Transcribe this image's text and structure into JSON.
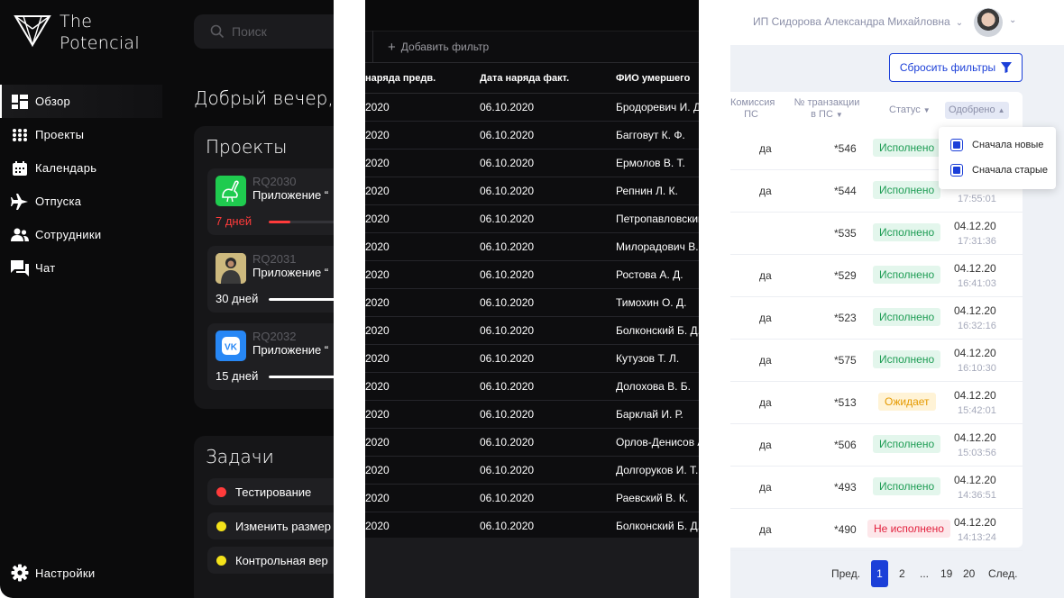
{
  "dashboard": {
    "logo_text": "The Potencial",
    "search_placeholder": "Поиск",
    "nav": [
      {
        "label": "Обзор",
        "icon": "grid-icon"
      },
      {
        "label": "Проекты",
        "icon": "dots-grid-icon"
      },
      {
        "label": "Календарь",
        "icon": "calendar-icon"
      },
      {
        "label": "Отпуска",
        "icon": "plane-icon"
      },
      {
        "label": "Сотрудники",
        "icon": "users-icon"
      },
      {
        "label": "Чат",
        "icon": "chat-icon"
      }
    ],
    "settings_label": "Настройки",
    "greeting": "Добрый вечер,",
    "projects_title": "Проекты",
    "projects": [
      {
        "code": "RQ2030",
        "name": "Приложение “",
        "days": "7 дней",
        "progress": 0.2,
        "bar_color": "#ff3b3b",
        "icon": "ostrich-app-icon"
      },
      {
        "code": "RQ2031",
        "name": "Приложение “",
        "days": "30 дней",
        "progress": 1.0,
        "bar_color": "#ffffff",
        "icon": "person-app-icon"
      },
      {
        "code": "RQ2032",
        "name": "Приложение “",
        "days": "15 дней",
        "progress": 1.0,
        "bar_color": "#ffffff",
        "icon": "vk-app-icon"
      }
    ],
    "tasks_title": "Задачи",
    "tasks": [
      {
        "label": "Тестирование",
        "color": "#ff3b3b"
      },
      {
        "label": "Изменить размер",
        "color": "#f4e21a"
      },
      {
        "label": "Контрольная вер",
        "color": "#f4e21a"
      }
    ]
  },
  "orders": {
    "add_filter": "Добавить фильтр",
    "headers": [
      "наряда предв.",
      "Дата наряда факт.",
      "ФИО умершего"
    ],
    "rows": [
      [
        "2020",
        "06.10.2020",
        "Бродоревич И. Д."
      ],
      [
        "2020",
        "06.10.2020",
        "Багговут К. Ф."
      ],
      [
        "2020",
        "06.10.2020",
        "Ермолов В. Т."
      ],
      [
        "2020",
        "06.10.2020",
        "Репнин Л. К."
      ],
      [
        "2020",
        "06.10.2020",
        "Петропавловский"
      ],
      [
        "2020",
        "06.10.2020",
        "Милорадович В."
      ],
      [
        "2020",
        "06.10.2020",
        "Ростова А. Д."
      ],
      [
        "2020",
        "06.10.2020",
        "Тимохин О. Д."
      ],
      [
        "2020",
        "06.10.2020",
        "Болконский Б. Д."
      ],
      [
        "2020",
        "06.10.2020",
        "Кутузов Т. Л."
      ],
      [
        "2020",
        "06.10.2020",
        "Долохова  В. Б."
      ],
      [
        "2020",
        "06.10.2020",
        "Барклай И. Р."
      ],
      [
        "2020",
        "06.10.2020",
        "Орлов-Денисов А."
      ],
      [
        "2020",
        "06.10.2020",
        "Долгоруков И. Т."
      ],
      [
        "2020",
        "06.10.2020",
        "Раевский В. К."
      ],
      [
        "2020",
        "06.10.2020",
        "Болконский Б. Д."
      ]
    ]
  },
  "transactions": {
    "user_name": "ИП Сидорова Александра Михайловна",
    "reset_filters": "Сбросить фильтры",
    "headers": {
      "commission": "Комиссия\nПС",
      "txn": "№ транзакции\nв ПС",
      "status": "Статус",
      "approved": "Одобрено"
    },
    "sort_menu": [
      "Сначала новые",
      "Сначала старые"
    ],
    "rows": [
      {
        "commission": "да",
        "txn": "*546",
        "status": "Исполнено",
        "status_type": "ok",
        "date": "",
        "time": ""
      },
      {
        "commission": "да",
        "txn": "*544",
        "status": "Исполнено",
        "status_type": "ok",
        "date": "",
        "time": "17:55:01"
      },
      {
        "commission": "",
        "txn": "*535",
        "status": "Исполнено",
        "status_type": "ok",
        "date": "04.12.20",
        "time": "17:31:36"
      },
      {
        "commission": "да",
        "txn": "*529",
        "status": "Исполнено",
        "status_type": "ok",
        "date": "04.12.20",
        "time": "16:41:03"
      },
      {
        "commission": "да",
        "txn": "*523",
        "status": "Исполнено",
        "status_type": "ok",
        "date": "04.12.20",
        "time": "16:32:16"
      },
      {
        "commission": "да",
        "txn": "*575",
        "status": "Исполнено",
        "status_type": "ok",
        "date": "04.12.20",
        "time": "16:10:30"
      },
      {
        "commission": "да",
        "txn": "*513",
        "status": "Ожидает",
        "status_type": "wait",
        "date": "04.12.20",
        "time": "15:42:01"
      },
      {
        "commission": "да",
        "txn": "*506",
        "status": "Исполнено",
        "status_type": "ok",
        "date": "04.12.20",
        "time": "15:03:56"
      },
      {
        "commission": "да",
        "txn": "*493",
        "status": "Исполнено",
        "status_type": "ok",
        "date": "04.12.20",
        "time": "14:36:51"
      },
      {
        "commission": "да",
        "txn": "*490",
        "status": "Не исполнено",
        "status_type": "fail",
        "date": "04.12.20",
        "time": "14:13:24"
      }
    ],
    "pager": {
      "prev": "Пред.",
      "current": "1",
      "pages": [
        "2",
        "...",
        "19",
        "20"
      ],
      "next": "След."
    }
  }
}
